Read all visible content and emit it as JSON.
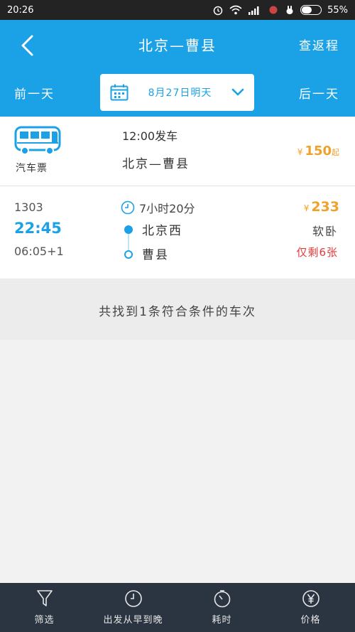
{
  "status_bar": {
    "time": "20:26",
    "battery": "55%",
    "battery_level": 0.55
  },
  "header": {
    "title": "北京—曹县",
    "return_label": "查返程",
    "prev_day": "前一天",
    "next_day": "后一天",
    "date_label": "8月27日明天"
  },
  "bus": {
    "label": "汽车票",
    "time": "12:00发车",
    "route": "北京—曹县",
    "price_symbol": "¥",
    "price": "150",
    "price_suffix": "起"
  },
  "train": {
    "number": "1303",
    "depart_time": "22:45",
    "arrive_time": "06:05+1",
    "duration": "7小时20分",
    "from_station": "北京西",
    "to_station": "曹县",
    "price_symbol": "¥",
    "price": "233",
    "seat_type": "软卧",
    "remaining": "仅剩6张"
  },
  "summary": "共找到1条符合条件的车次",
  "bottom_nav": [
    {
      "label": "筛选",
      "icon": "filter-icon"
    },
    {
      "label": "出发从早到晚",
      "icon": "clock-icon"
    },
    {
      "label": "耗时",
      "icon": "timer-icon"
    },
    {
      "label": "价格",
      "icon": "yen-icon"
    }
  ],
  "colors": {
    "primary": "#1ba2e6",
    "price": "#f0a12c",
    "alert": "#e03b3b",
    "bottom_bar": "#2b3441"
  }
}
